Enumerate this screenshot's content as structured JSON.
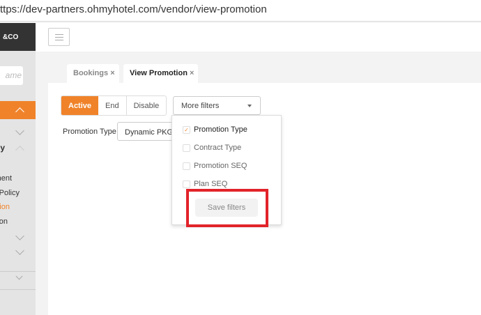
{
  "browser": {
    "url": "ttps://dev-partners.ohmyhotel.com/vendor/view-promotion"
  },
  "sidebar": {
    "logo": "&CO",
    "search_placeholder": "ame",
    "items": [
      {
        "label": "y"
      },
      {
        "label": "ement"
      },
      {
        "label": "Policy"
      },
      {
        "label": "tion"
      },
      {
        "label": "on"
      }
    ]
  },
  "tabs": [
    {
      "label": "Bookings",
      "close": "×"
    },
    {
      "label": "View Promotion",
      "close": "×"
    }
  ],
  "status_filter": [
    "Active",
    "End",
    "Disable"
  ],
  "more_filters": {
    "label": "More filters",
    "options": [
      {
        "label": "Promotion Type",
        "checked": true
      },
      {
        "label": "Contract Type",
        "checked": false
      },
      {
        "label": "Promotion SEQ",
        "checked": false
      },
      {
        "label": "Plan SEQ",
        "checked": false
      }
    ],
    "save_label": "Save filters"
  },
  "promotion_type": {
    "label": "Promotion Type",
    "value": "Dynamic PKG"
  },
  "colors": {
    "accent": "#f0832a",
    "highlight": "#e2232a"
  }
}
